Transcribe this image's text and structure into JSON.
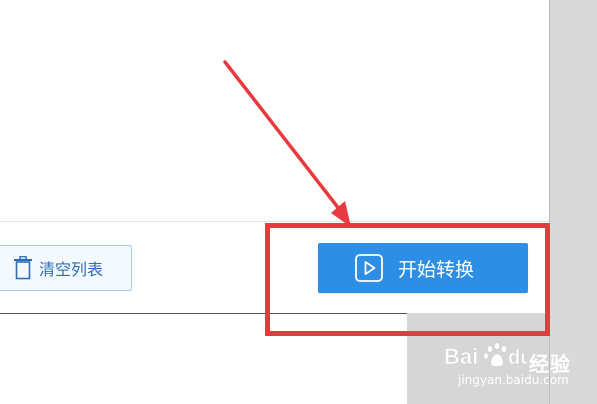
{
  "toolbar": {
    "clear_list_label": "清空列表",
    "start_convert_label": "开始转换"
  },
  "icons": {
    "clear_list": "trash-icon",
    "start_convert": "play-icon"
  },
  "annotation": {
    "color": "#e8393f"
  },
  "watermark": {
    "text": "经验",
    "url": "jingyan.baidu.com"
  },
  "colors": {
    "primary_button": "#2d8ee6",
    "secondary_button_text": "#2c6fb5"
  }
}
